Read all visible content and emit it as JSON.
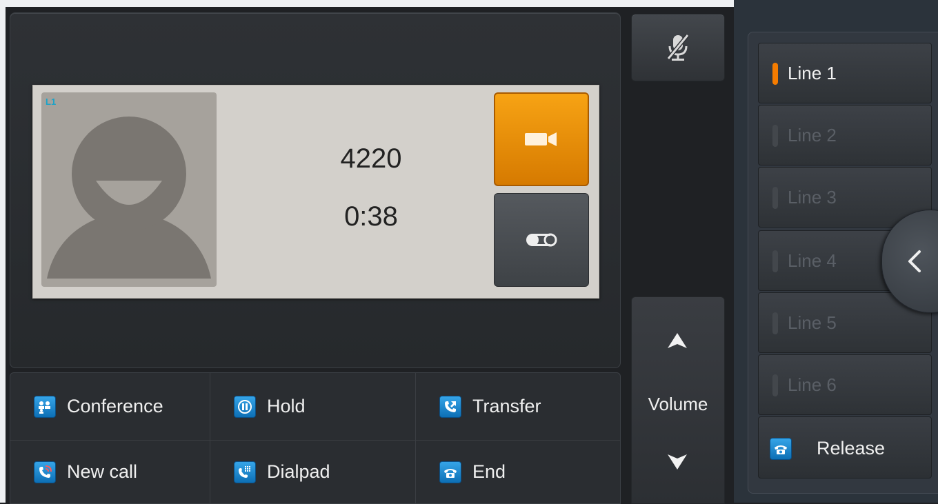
{
  "call": {
    "line_tag": "L1",
    "number": "4220",
    "duration": "0:38"
  },
  "actions": {
    "conference": "Conference",
    "hold": "Hold",
    "transfer": "Transfer",
    "new_call": "New call",
    "dialpad": "Dialpad",
    "end": "End"
  },
  "volume": {
    "label": "Volume"
  },
  "lines": [
    {
      "label": "Line 1",
      "active": true
    },
    {
      "label": "Line 2",
      "active": false
    },
    {
      "label": "Line 3",
      "active": false
    },
    {
      "label": "Line 4",
      "active": false
    },
    {
      "label": "Line 5",
      "active": false
    },
    {
      "label": "Line 6",
      "active": false
    }
  ],
  "release": {
    "label": "Release"
  },
  "colors": {
    "accent": "#f57c00",
    "video_button": "#e88b00",
    "icon_blue": "#1f8bd6",
    "card_bg": "#d3d0cb"
  },
  "icons": {
    "mute": "mic-muted-icon",
    "video": "video-camera-icon",
    "voicemail": "voicemail-icon",
    "conference": "conference-icon",
    "hold": "pause-icon",
    "transfer": "transfer-icon",
    "new_call": "phone-ring-icon",
    "dialpad": "dialpad-icon",
    "end": "hang-up-icon",
    "release": "hang-up-icon",
    "collapse": "chevron-left-icon"
  }
}
